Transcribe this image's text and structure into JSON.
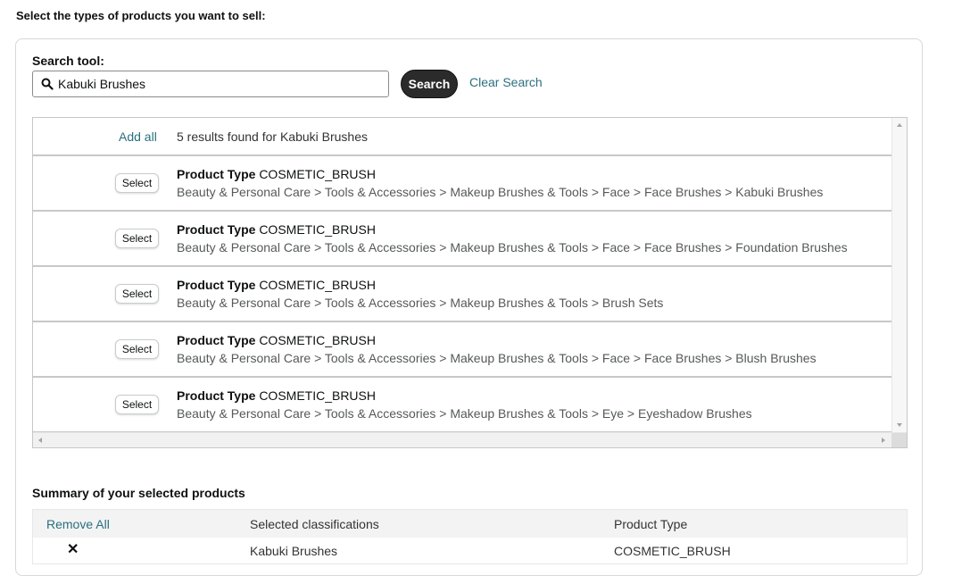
{
  "intro": "Select the types of products you want to sell:",
  "search": {
    "label": "Search tool:",
    "value": "Kabuki Brushes",
    "button_label": "Search",
    "clear_label": "Clear Search"
  },
  "results": {
    "add_all_label": "Add all",
    "count_text": "5 results found for Kabuki Brushes",
    "select_label": "Select",
    "product_type_label": "Product Type",
    "items": [
      {
        "product_type": "COSMETIC_BRUSH",
        "path": "Beauty & Personal Care > Tools & Accessories > Makeup Brushes & Tools > Face > Face Brushes > Kabuki Brushes"
      },
      {
        "product_type": "COSMETIC_BRUSH",
        "path": "Beauty & Personal Care > Tools & Accessories > Makeup Brushes & Tools > Face > Face Brushes > Foundation Brushes"
      },
      {
        "product_type": "COSMETIC_BRUSH",
        "path": "Beauty & Personal Care > Tools & Accessories > Makeup Brushes & Tools > Brush Sets"
      },
      {
        "product_type": "COSMETIC_BRUSH",
        "path": "Beauty & Personal Care > Tools & Accessories > Makeup Brushes & Tools > Face > Face Brushes > Blush Brushes"
      },
      {
        "product_type": "COSMETIC_BRUSH",
        "path": "Beauty & Personal Care > Tools & Accessories > Makeup Brushes & Tools > Eye > Eyeshadow Brushes"
      }
    ]
  },
  "summary": {
    "title": "Summary of your selected products",
    "remove_all_label": "Remove All",
    "col_classifications": "Selected classifications",
    "col_product_type": "Product Type",
    "rows": [
      {
        "remove_icon": "close-icon",
        "classification": "Kabuki Brushes",
        "product_type": "COSMETIC_BRUSH"
      }
    ]
  },
  "icons": {
    "search": "search-icon",
    "remove": "close-icon"
  },
  "colors": {
    "link": "#2a6f7f",
    "primary_button": "#2b2b2b",
    "panel_border": "#d5d9d9"
  }
}
